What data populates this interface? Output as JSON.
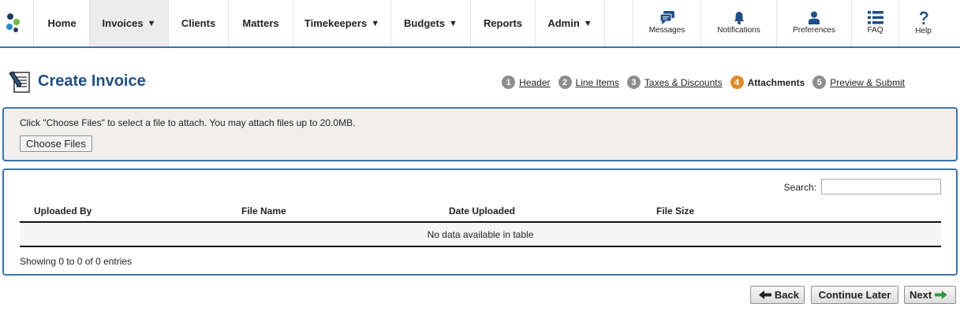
{
  "nav": {
    "logo_icon": "brand-logo-icon",
    "items": [
      {
        "label": "Home",
        "dropdown": false
      },
      {
        "label": "Invoices",
        "dropdown": true,
        "active": true
      },
      {
        "label": "Clients",
        "dropdown": false
      },
      {
        "label": "Matters",
        "dropdown": false
      },
      {
        "label": "Timekeepers",
        "dropdown": true
      },
      {
        "label": "Budgets",
        "dropdown": true
      },
      {
        "label": "Reports",
        "dropdown": false
      },
      {
        "label": "Admin",
        "dropdown": true
      }
    ],
    "caret": "▼",
    "right": [
      {
        "label": "Messages",
        "icon": "messages-icon"
      },
      {
        "label": "Notifications",
        "icon": "bell-icon"
      },
      {
        "label": "Preferences",
        "icon": "user-icon"
      },
      {
        "label": "FAQ",
        "icon": "list-icon"
      },
      {
        "label": "Help",
        "icon": "question-icon"
      }
    ]
  },
  "page": {
    "title": "Create Invoice",
    "title_icon": "invoice-edit-icon",
    "steps": [
      {
        "num": "1",
        "label": "Header"
      },
      {
        "num": "2",
        "label": "Line Items"
      },
      {
        "num": "3",
        "label": "Taxes & Discounts"
      },
      {
        "num": "4",
        "label": "Attachments",
        "current": true
      },
      {
        "num": "5",
        "label": "Preview & Submit"
      }
    ]
  },
  "upload": {
    "info": "Click \"Choose Files\" to select a file to attach. You may attach files up to 20.0MB.",
    "button": "Choose Files"
  },
  "table": {
    "search_label": "Search:",
    "search_value": "",
    "columns": [
      "Uploaded By",
      "File Name",
      "Date Uploaded",
      "File Size"
    ],
    "empty_text": "No data available in table",
    "info": "Showing 0 to 0 of 0 entries"
  },
  "footer": {
    "back": "Back",
    "continue_later": "Continue Later",
    "next": "Next"
  },
  "colors": {
    "accent": "#3b73b0",
    "title": "#1f4f86",
    "current_step": "#e08a26",
    "next_arrow": "#2e9b3a"
  }
}
